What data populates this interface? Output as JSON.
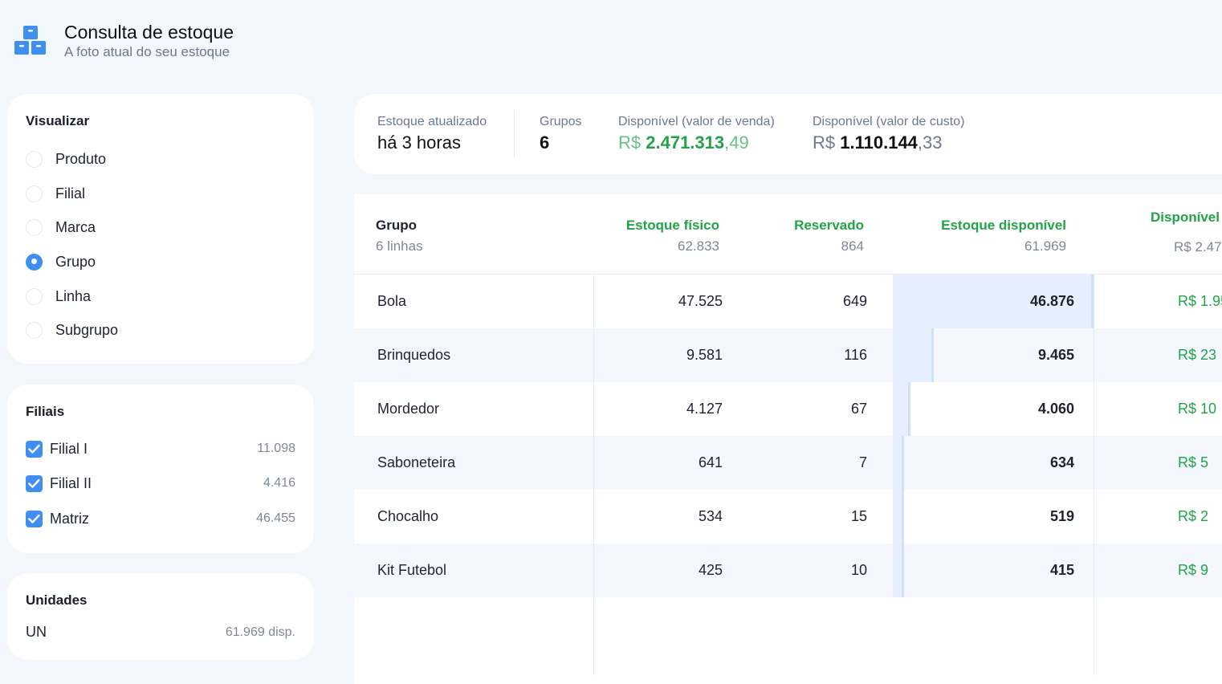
{
  "header": {
    "title": "Consulta de estoque",
    "subtitle": "A foto atual do seu estoque",
    "icon": "boxes-stack-icon",
    "accent_color": "#3f8ff2"
  },
  "visualizar": {
    "title": "Visualizar",
    "options": [
      {
        "label": "Produto",
        "checked": false
      },
      {
        "label": "Filial",
        "checked": false
      },
      {
        "label": "Marca",
        "checked": false
      },
      {
        "label": "Grupo",
        "checked": true
      },
      {
        "label": "Linha",
        "checked": false
      },
      {
        "label": "Subgrupo",
        "checked": false
      }
    ]
  },
  "filiais": {
    "title": "Filiais",
    "items": [
      {
        "label": "Filial I",
        "value": "11.098",
        "checked": true
      },
      {
        "label": "Filial II",
        "value": "4.416",
        "checked": true
      },
      {
        "label": "Matriz",
        "value": "46.455",
        "checked": true
      }
    ]
  },
  "unidades": {
    "title": "Unidades",
    "items": [
      {
        "label": "UN",
        "value": "61.969 disp."
      }
    ]
  },
  "summary": {
    "updated_label": "Estoque atualizado",
    "updated_value": "há 3 horas",
    "grupos_label": "Grupos",
    "grupos_value": "6",
    "venda_label": "Disponível (valor de venda)",
    "venda_currency": "R$",
    "venda_integer": "2.471.313",
    "venda_cents": ",49",
    "custo_label": "Disponível (valor de custo)",
    "custo_currency": "R$",
    "custo_integer": "1.110.144",
    "custo_cents": ",33"
  },
  "table": {
    "columns": [
      {
        "title": "Grupo",
        "sub": "6 linhas"
      },
      {
        "title": "Estoque físico",
        "sub": "62.833"
      },
      {
        "title": "Reservado",
        "sub": "864"
      },
      {
        "title": "Estoque disponível",
        "sub": "61.969"
      },
      {
        "title": "Disponível",
        "sub": "R$ 2.47"
      }
    ],
    "rows": [
      {
        "grupo": "Bola",
        "fisico": "47.525",
        "reservado": "649",
        "disponivel": "46.876",
        "valor": "R$ 1.95",
        "bar_fraction": 1.0
      },
      {
        "grupo": "Brinquedos",
        "fisico": "9.581",
        "reservado": "116",
        "disponivel": "9.465",
        "valor": "R$ 23",
        "bar_fraction": 0.202
      },
      {
        "grupo": "Mordedor",
        "fisico": "4.127",
        "reservado": "67",
        "disponivel": "4.060",
        "valor": "R$ 10",
        "bar_fraction": 0.087
      },
      {
        "grupo": "Saboneteira",
        "fisico": "641",
        "reservado": "7",
        "disponivel": "634",
        "valor": "R$ 5",
        "bar_fraction": 0.014
      },
      {
        "grupo": "Chocalho",
        "fisico": "534",
        "reservado": "15",
        "disponivel": "519",
        "valor": "R$ 2",
        "bar_fraction": 0.011
      },
      {
        "grupo": "Kit Futebol",
        "fisico": "425",
        "reservado": "10",
        "disponivel": "415",
        "valor": "R$ 9",
        "bar_fraction": 0.009
      }
    ]
  }
}
